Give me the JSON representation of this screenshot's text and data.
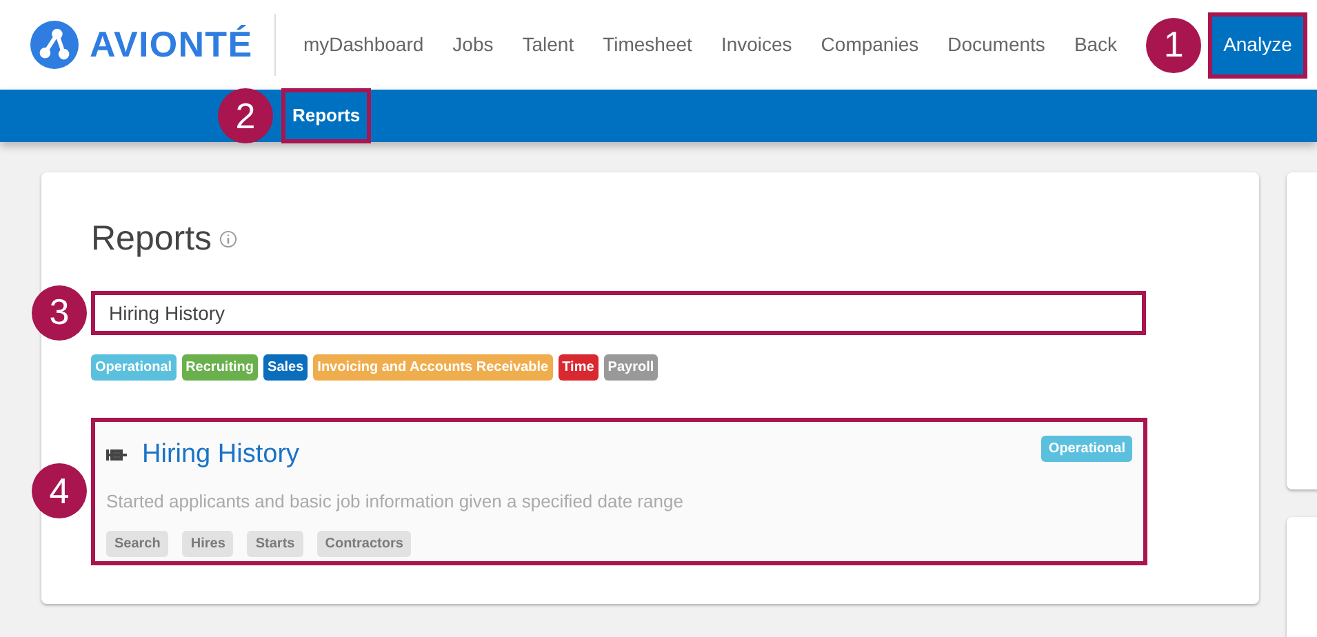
{
  "brand": {
    "name": "AVIONTÉ"
  },
  "nav": {
    "items": [
      {
        "label": "myDashboard",
        "selected": false
      },
      {
        "label": "Jobs",
        "selected": false
      },
      {
        "label": "Talent",
        "selected": false
      },
      {
        "label": "Timesheet",
        "selected": false
      },
      {
        "label": "Invoices",
        "selected": false
      },
      {
        "label": "Companies",
        "selected": false
      },
      {
        "label": "Documents",
        "selected": false
      },
      {
        "label": "Back",
        "selected": false
      },
      {
        "label": "Analyze",
        "selected": true,
        "callout": "1"
      }
    ]
  },
  "subnav": {
    "items": [
      {
        "label": "Reports",
        "callout": "2"
      }
    ]
  },
  "page": {
    "title": "Reports",
    "search": {
      "value": "Hiring History",
      "callout": "3"
    },
    "categories": [
      {
        "label": "Operational",
        "color": "#5bc0de"
      },
      {
        "label": "Recruiting",
        "color": "#6ab04c"
      },
      {
        "label": "Sales",
        "color": "#0a6ebd"
      },
      {
        "label": "Invoicing and Accounts Receivable",
        "color": "#f0ad4e"
      },
      {
        "label": "Time",
        "color": "#d9282f"
      },
      {
        "label": "Payroll",
        "color": "#999999"
      }
    ],
    "results": [
      {
        "title": "Hiring History",
        "description": "Started applicants and basic job information given a specified date range",
        "category": {
          "label": "Operational",
          "color": "#5bc0de"
        },
        "tags": [
          "Search",
          "Hires",
          "Starts",
          "Contractors"
        ],
        "callout": "4"
      }
    ]
  }
}
